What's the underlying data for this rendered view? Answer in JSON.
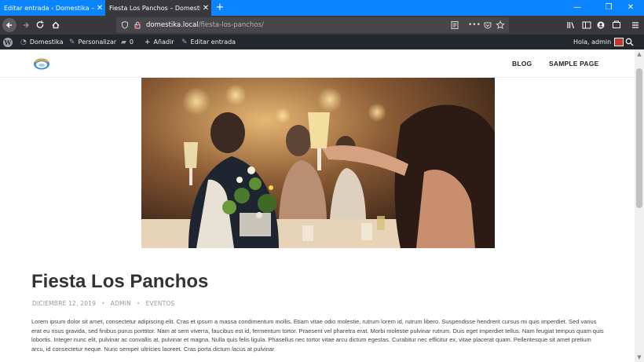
{
  "browser": {
    "tabs": [
      {
        "title": "Editar entrada ‹ Domestika — Wor"
      },
      {
        "title": "Fiesta Los Panchos – Domestika"
      }
    ],
    "new_tab": "+",
    "window_controls": [
      "—",
      "❐",
      "✕"
    ],
    "url": {
      "domain": "domestika.local",
      "path": "/fiesta-los-panchos/"
    }
  },
  "adminbar": {
    "site": "Domestika",
    "customize": "Personalizar",
    "comments_count": "0",
    "add_new": "Añadir",
    "edit_post": "Editar entrada",
    "greeting": "Hola, admin"
  },
  "site": {
    "menu": [
      "BLOG",
      "SAMPLE PAGE"
    ]
  },
  "post": {
    "title": "Fiesta Los Panchos",
    "date": "DICIEMBRE 12, 2019",
    "author": "ADMIN",
    "category": "EVENTOS",
    "body": "Lorem ipsum dolor sit amet, consectetur adipiscing elit. Cras et ipsum a massa condimentum mollis. Etiam vitae odio molestie, rutrum lorem id, rutrum libero. Suspendisse hendrerit cursus mi quis imperdiet. Sed varius erat eu risus gravida, sed finibus purus porttitor. Nam at sem viverra, faucibus est id, fermentum tortor. Praesent vel pharetra erat. Morbi molestie pulvinar rutrum. Duis eget imperdiet tellus. Nam feugiat tempus quam quis lobortis. Integer nunc elit, pulvinar ac convallis at, pulvinar et magna. Nulla quis felis ligula. Phasellus nec tortor vitae arcu dictum egestas. Curabitur nec efficitur ex, vitae placerat quam. Pellentesque sit amet pretium arcu, id consectetur neque. Nunc semper ultricies laoreet. Cras porta dictum lacus at pulvinar."
  },
  "colors": {
    "tabstrip": "#0a84ff",
    "toolbar": "#38383d",
    "adminbar": "#23282d"
  }
}
